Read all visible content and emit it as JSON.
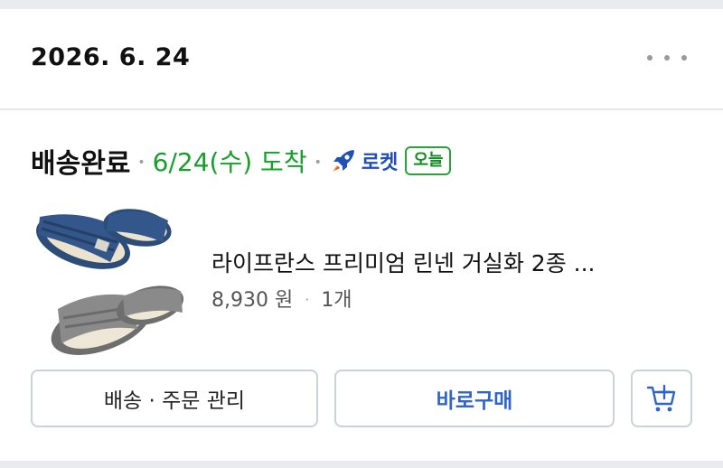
{
  "order": {
    "date": "2026. 6. 24"
  },
  "delivery": {
    "status": "배송완료",
    "arrival": "6/24(수) 도착",
    "rocket_label": "로켓",
    "today_badge": "오늘"
  },
  "product": {
    "name": "라이프란스 프리미엄 린넨 거실화 2종 ...",
    "price": "8,930 원",
    "separator": "·",
    "quantity": "1개"
  },
  "buttons": {
    "manage": "배송 · 주문 관리",
    "buy_again": "바로구매",
    "cart_icon": "cart-add-icon"
  },
  "colors": {
    "arrival_green": "#16a02a",
    "rocket_blue": "#1f4fb7",
    "buy_blue": "#2f64c9"
  }
}
